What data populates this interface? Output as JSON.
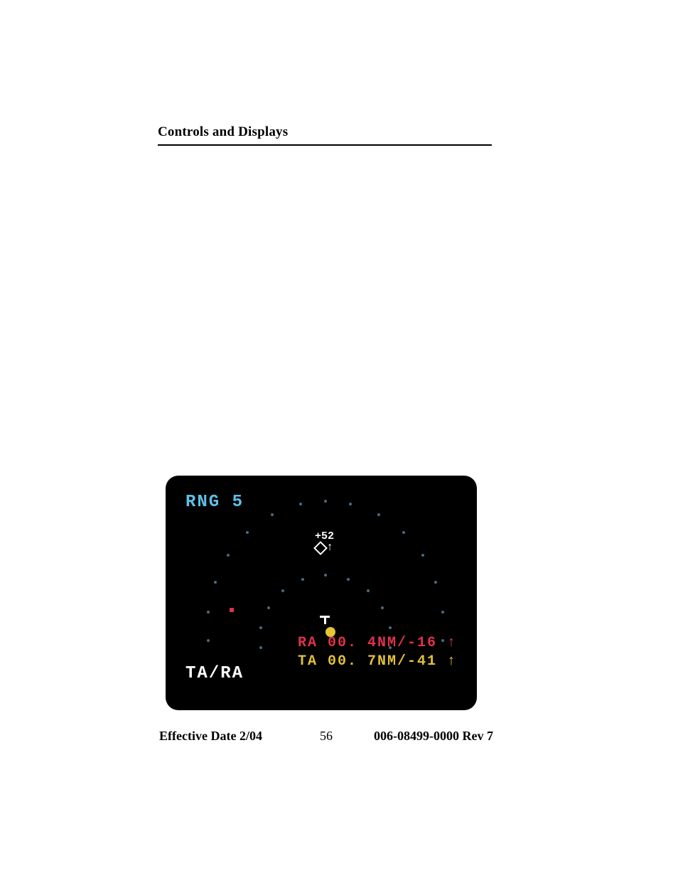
{
  "header": {
    "section_title": "Controls and Displays"
  },
  "display": {
    "range_label": "RNG 5",
    "mode_label": "TA/RA",
    "ra_line": "RA 00. 4NM/-16 ↑",
    "ta_line": "TA 00. 7NM/-41 ↑",
    "colors": {
      "range": "#5fbfe8",
      "mode": "#ffffff",
      "ra": "#e0324b",
      "ta": "#e2c23a",
      "ta_symbol": "#e5c637",
      "traffic_default": "#ffffff"
    },
    "traffic_other": {
      "altitude_tag": "+52",
      "trend": "↑"
    }
  },
  "footer": {
    "effective_date": "Effective Date 2/04",
    "page_number": "56",
    "doc_id": "006-08499-0000 Rev 7"
  }
}
